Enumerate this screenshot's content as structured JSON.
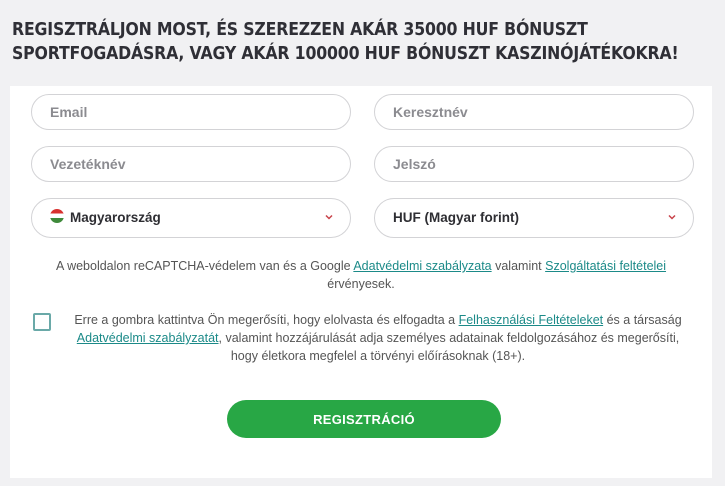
{
  "headline": {
    "line1": "REGISZTRÁLJON MOST, ÉS SZEREZZEN AKÁR 35000 HUF BÓNUSZT",
    "line2": "SPORTFOGADÁSRA, VAGY AKÁR 100000 HUF BÓNUSZT KASZINÓJÁTÉKOKRA!"
  },
  "form": {
    "email_placeholder": "Email",
    "firstname_placeholder": "Keresztnév",
    "lastname_placeholder": "Vezetéknév",
    "password_placeholder": "Jelszó",
    "country_value": "Magyarország",
    "currency_value": "HUF (Magyar forint)"
  },
  "recaptcha": {
    "before": "A weboldalon reCAPTCHA-védelem van és a Google ",
    "privacy_link": "Adatvédelmi szabályzata",
    "middle": " valamint ",
    "terms_link": "Szolgáltatási feltételei",
    "after": " érvényesek."
  },
  "consent": {
    "part1": "Erre a gombra kattintva Ön megerősíti, hogy elolvasta és elfogadta a ",
    "terms_link": "Felhasználási Feltételeket",
    "part2": " és a társaság ",
    "privacy_link": "Adatvédelmi szabályzatát",
    "part3": ", valamint hozzájárulását adja személyes adatainak feldolgozásához és megerősíti, hogy életkora megfelel a törvényi előírásoknak (18+)."
  },
  "register_label": "REGISZTRÁCIÓ",
  "colors": {
    "accent_green": "#28a745",
    "link_teal": "#1b8a88",
    "chevron_red": "#c8424a"
  }
}
